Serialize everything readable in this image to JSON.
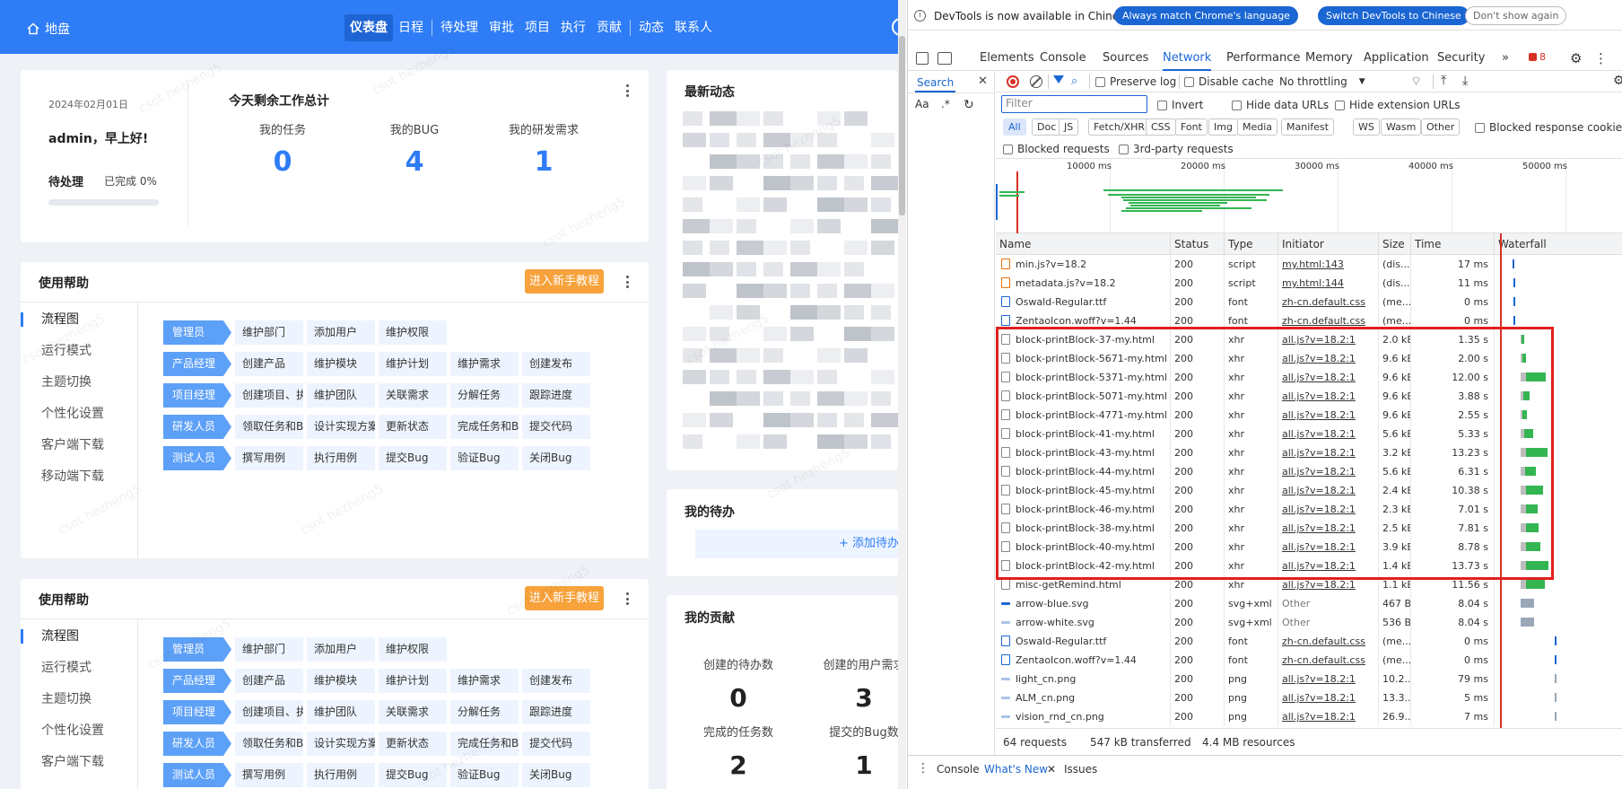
{
  "app": {
    "brand": "地盘",
    "nav": [
      {
        "label": "仪表盘",
        "active": true
      },
      {
        "label": "日程"
      },
      {
        "sep": true
      },
      {
        "label": "待处理"
      },
      {
        "label": "审批"
      },
      {
        "label": "项目"
      },
      {
        "label": "执行"
      },
      {
        "label": "贡献"
      },
      {
        "sep": true
      },
      {
        "label": "动态"
      },
      {
        "label": "联系人"
      }
    ]
  },
  "welcome": {
    "date": "2024年02月01日",
    "greeting": "admin，早上好!",
    "pending_label": "待处理",
    "done_label": "已完成 0%",
    "progress": 0,
    "summary_title": "今天剩余工作总计",
    "stats": [
      {
        "label": "我的任务",
        "value": "0"
      },
      {
        "label": "我的BUG",
        "value": "4"
      },
      {
        "label": "我的研发需求",
        "value": "1"
      }
    ]
  },
  "help": {
    "title": "使用帮助",
    "tutorial_button": "进入新手教程",
    "side_items": [
      "流程图",
      "运行模式",
      "主题切换",
      "个性化设置",
      "客户端下载",
      "移动端下载"
    ],
    "side_items_2": [
      "流程图",
      "运行模式",
      "主题切换",
      "个性化设置",
      "客户端下载"
    ],
    "flow": [
      {
        "role": "管理员",
        "steps": [
          "维护部门",
          "添加用户",
          "维护权限"
        ]
      },
      {
        "role": "产品经理",
        "steps": [
          "创建产品",
          "维护模块",
          "维护计划",
          "维护需求",
          "创建发布"
        ]
      },
      {
        "role": "项目经理",
        "steps": [
          "创建项目、执行",
          "维护团队",
          "关联需求",
          "分解任务",
          "跟踪进度"
        ]
      },
      {
        "role": "研发人员",
        "steps": [
          "领取任务和Bug",
          "设计实现方案",
          "更新状态",
          "完成任务和Bug",
          "提交代码"
        ]
      },
      {
        "role": "测试人员",
        "steps": [
          "撰写用例",
          "执行用例",
          "提交Bug",
          "验证Bug",
          "关闭Bug"
        ]
      }
    ]
  },
  "feed": {
    "title": "最新动态"
  },
  "todo": {
    "title": "我的待办",
    "add_label": "+ 添加待办"
  },
  "contrib": {
    "title": "我的贡献",
    "stats": [
      {
        "label": "创建的待办数",
        "value": "0"
      },
      {
        "label": "创建的用户需求",
        "value": "3"
      },
      {
        "label": "完成的任务数",
        "value": "2"
      },
      {
        "label": "提交的Bug数",
        "value": "1"
      }
    ]
  },
  "watermark": "csot hezheng5",
  "devtools": {
    "info_message": "DevTools is now available in Chinese!",
    "btn_match": "Always match Chrome's language",
    "btn_switch": "Switch DevTools to Chinese",
    "btn_dismiss": "Don't show again",
    "tabs": [
      "Elements",
      "Console",
      "Sources",
      "Network",
      "Performance",
      "Memory",
      "Application",
      "Security"
    ],
    "active_tab": "Network",
    "error_count": "8",
    "search_tab": "Search",
    "search_aa": "Aa",
    "search_regex": ".*",
    "preserve_log": "Preserve log",
    "disable_cache": "Disable cache",
    "throttling": "No throttling",
    "filter_placeholder": "Filter",
    "invert": "Invert",
    "hide_data_urls": "Hide data URLs",
    "hide_ext_urls": "Hide extension URLs",
    "type_filters": [
      "All",
      "Doc",
      "JS",
      "Fetch/XHR",
      "CSS",
      "Font",
      "Img",
      "Media",
      "Manifest",
      "WS",
      "Wasm",
      "Other"
    ],
    "blocked_cookies": "Blocked response cookies",
    "blocked_requests": "Blocked requests",
    "third_party": "3rd-party requests",
    "timeline_ticks": [
      "10000 ms",
      "20000 ms",
      "30000 ms",
      "40000 ms",
      "50000 ms"
    ],
    "columns": [
      "Name",
      "Status",
      "Type",
      "Initiator",
      "Size",
      "Time",
      "Waterfall"
    ],
    "rows": [
      {
        "name": "min.js?v=18.2",
        "status": "200",
        "type": "script",
        "initiator": "my.html:143",
        "size": "(dis...",
        "time": "17 ms",
        "icon": "script",
        "wf": [
          0.01,
          0.012
        ]
      },
      {
        "name": "metadata.js?v=18.2",
        "status": "200",
        "type": "script",
        "initiator": "my.html:144",
        "size": "(dis...",
        "time": "11 ms",
        "icon": "script",
        "wf": [
          0.011,
          0.011
        ]
      },
      {
        "name": "Oswald-Regular.ttf",
        "status": "200",
        "type": "font",
        "initiator": "zh-cn.default.css",
        "size": "(me...",
        "time": "0 ms",
        "icon": "font",
        "wf": [
          0.012,
          0.004
        ]
      },
      {
        "name": "ZentaoIcon.woff?v=1.44",
        "status": "200",
        "type": "font",
        "initiator": "zh-cn.default.css",
        "size": "(me...",
        "time": "0 ms",
        "icon": "font",
        "wf": [
          0.012,
          0.004
        ]
      },
      {
        "name": "block-printBlock-37-my.html",
        "status": "200",
        "type": "xhr",
        "initiator": "all.js?v=18.2:1",
        "size": "2.0 kB",
        "time": "1.35 s",
        "icon": "doc",
        "wf": [
          0.03,
          0.03
        ]
      },
      {
        "name": "block-printBlock-5671-my.html",
        "status": "200",
        "type": "xhr",
        "initiator": "all.js?v=18.2:1",
        "size": "9.6 kB",
        "time": "2.00 s",
        "icon": "doc",
        "wf": [
          0.03,
          0.04
        ]
      },
      {
        "name": "block-printBlock-5371-my.html",
        "status": "200",
        "type": "xhr",
        "initiator": "all.js?v=18.2:1",
        "size": "9.6 kB",
        "time": "12.00 s",
        "icon": "doc",
        "wf": [
          0.03,
          0.22
        ]
      },
      {
        "name": "block-printBlock-5071-my.html",
        "status": "200",
        "type": "xhr",
        "initiator": "all.js?v=18.2:1",
        "size": "9.6 kB",
        "time": "3.88 s",
        "icon": "doc",
        "wf": [
          0.03,
          0.07
        ]
      },
      {
        "name": "block-printBlock-4771-my.html",
        "status": "200",
        "type": "xhr",
        "initiator": "all.js?v=18.2:1",
        "size": "9.6 kB",
        "time": "2.55 s",
        "icon": "doc",
        "wf": [
          0.03,
          0.05
        ]
      },
      {
        "name": "block-printBlock-41-my.html",
        "status": "200",
        "type": "xhr",
        "initiator": "all.js?v=18.2:1",
        "size": "5.6 kB",
        "time": "5.33 s",
        "icon": "doc",
        "wf": [
          0.03,
          0.1
        ]
      },
      {
        "name": "block-printBlock-43-my.html",
        "status": "200",
        "type": "xhr",
        "initiator": "all.js?v=18.2:1",
        "size": "3.2 kB",
        "time": "13.23 s",
        "icon": "doc",
        "wf": [
          0.03,
          0.24
        ]
      },
      {
        "name": "block-printBlock-44-my.html",
        "status": "200",
        "type": "xhr",
        "initiator": "all.js?v=18.2:1",
        "size": "5.6 kB",
        "time": "6.31 s",
        "icon": "doc",
        "wf": [
          0.03,
          0.12
        ]
      },
      {
        "name": "block-printBlock-45-my.html",
        "status": "200",
        "type": "xhr",
        "initiator": "all.js?v=18.2:1",
        "size": "2.4 kB",
        "time": "10.38 s",
        "icon": "doc",
        "wf": [
          0.03,
          0.19
        ]
      },
      {
        "name": "block-printBlock-46-my.html",
        "status": "200",
        "type": "xhr",
        "initiator": "all.js?v=18.2:1",
        "size": "2.3 kB",
        "time": "7.01 s",
        "icon": "doc",
        "wf": [
          0.03,
          0.13
        ]
      },
      {
        "name": "block-printBlock-38-my.html",
        "status": "200",
        "type": "xhr",
        "initiator": "all.js?v=18.2:1",
        "size": "2.5 kB",
        "time": "7.81 s",
        "icon": "doc",
        "wf": [
          0.03,
          0.14
        ]
      },
      {
        "name": "block-printBlock-40-my.html",
        "status": "200",
        "type": "xhr",
        "initiator": "all.js?v=18.2:1",
        "size": "3.9 kB",
        "time": "8.78 s",
        "icon": "doc",
        "wf": [
          0.03,
          0.16
        ]
      },
      {
        "name": "block-printBlock-42-my.html",
        "status": "200",
        "type": "xhr",
        "initiator": "all.js?v=18.2:1",
        "size": "1.4 kB",
        "time": "13.73 s",
        "icon": "doc",
        "wf": [
          0.03,
          0.25
        ]
      },
      {
        "name": "misc-getRemind.html",
        "status": "200",
        "type": "xhr",
        "initiator": "all.js?v=18.2:1",
        "size": "1.1 kB",
        "time": "11.56 s",
        "icon": "doc",
        "wf": [
          0.03,
          0.21
        ]
      },
      {
        "name": "arrow-blue.svg",
        "status": "200",
        "type": "svg+xml",
        "initiator": "Other",
        "size": "467 B",
        "time": "8.04 s",
        "icon": "svg",
        "wf": [
          0.03,
          0.15
        ]
      },
      {
        "name": "arrow-white.svg",
        "status": "200",
        "type": "svg+xml",
        "initiator": "Other",
        "size": "536 B",
        "time": "8.04 s",
        "icon": "img",
        "wf": [
          0.03,
          0.15
        ]
      },
      {
        "name": "Oswald-Regular.ttf",
        "status": "200",
        "type": "font",
        "initiator": "zh-cn.default.css",
        "size": "(me...",
        "time": "0 ms",
        "icon": "font",
        "wf": [
          0.12,
          0.004
        ]
      },
      {
        "name": "ZentaoIcon.woff?v=1.44",
        "status": "200",
        "type": "font",
        "initiator": "zh-cn.default.css",
        "size": "(me...",
        "time": "0 ms",
        "icon": "font",
        "wf": [
          0.12,
          0.004
        ]
      },
      {
        "name": "light_cn.png",
        "status": "200",
        "type": "png",
        "initiator": "all.js?v=18.2:1",
        "size": "10.2...",
        "time": "79 ms",
        "icon": "img",
        "wf": [
          0.12,
          0.02
        ]
      },
      {
        "name": "ALM_cn.png",
        "status": "200",
        "type": "png",
        "initiator": "all.js?v=18.2:1",
        "size": "13.3...",
        "time": "5 ms",
        "icon": "img",
        "wf": [
          0.12,
          0.01
        ]
      },
      {
        "name": "vision_rnd_cn.png",
        "status": "200",
        "type": "png",
        "initiator": "all.js?v=18.2:1",
        "size": "26.9...",
        "time": "7 ms",
        "icon": "img",
        "wf": [
          0.12,
          0.01
        ]
      }
    ],
    "summary_requests": "64 requests",
    "summary_transferred": "547 kB transferred",
    "summary_resources": "4.4 MB resources",
    "drawer_tabs": [
      "Console",
      "What's New",
      "Issues"
    ],
    "drawer_active": "What's New"
  }
}
